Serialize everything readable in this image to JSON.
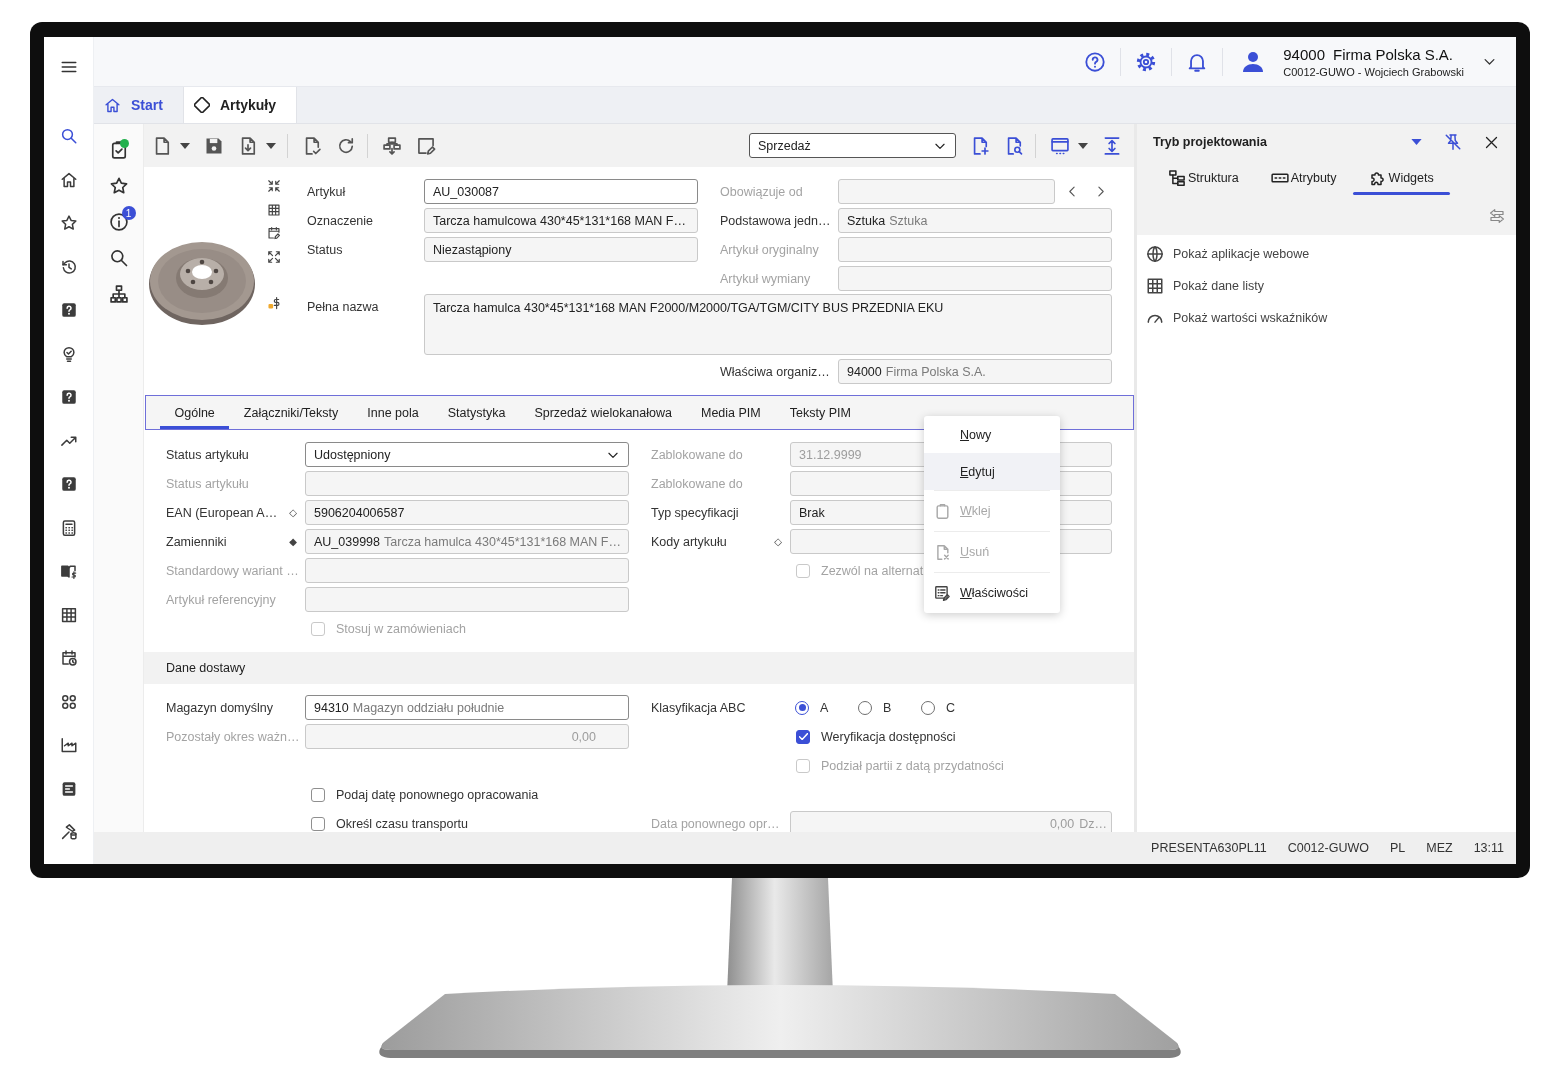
{
  "nav_rail": [
    {
      "selected": true
    },
    {
      "selected": false
    },
    {
      "selected": false
    },
    {
      "selected": false
    },
    {
      "selected": false
    },
    {
      "selected": false
    },
    {
      "selected": false
    },
    {
      "selected": false
    },
    {
      "selected": false
    },
    {
      "selected": false
    },
    {
      "selected": false
    },
    {
      "selected": false
    },
    {
      "selected": false
    },
    {
      "selected": false
    },
    {
      "selected": false
    },
    {
      "selected": false
    },
    {
      "selected": false
    }
  ],
  "top_bar": {
    "company_code": "94000",
    "company_name": "Firma Polska S.A.",
    "user": "C0012-GUWO - Wojciech Grabowski"
  },
  "page_tabs": [
    {
      "label": "Start",
      "kind": "home",
      "selected": false
    },
    {
      "label": "Artykuły",
      "kind": "record",
      "selected": true
    }
  ],
  "tool_rail": {
    "task_dot": true,
    "info_badge": "1"
  },
  "toolbar": {
    "view": "Sprzedaż"
  },
  "article_header": {
    "rows": [
      {
        "left": {
          "kind": "input",
          "label": "Artykuł",
          "value": "AU_030087",
          "editable": true,
          "disabled": false
        },
        "right": {
          "kind": "input",
          "label": "Obowiązuje od",
          "editable": false,
          "disabled": true,
          "nav_arrows": true
        }
      },
      {
        "left": {
          "kind": "input",
          "label": "Oznaczenie",
          "value": "Tarcza hamulcowa 430*45*131*168 MAN F…",
          "editable": false,
          "disabled": false
        },
        "right": {
          "kind": "input",
          "label": "Podstawowa jedn…",
          "value": "Sztuka",
          "description": "Sztuka",
          "editable": false,
          "disabled": false
        }
      },
      {
        "left": {
          "kind": "input",
          "label": "Status",
          "value": "Niezastąpiony",
          "editable": false,
          "disabled": false
        },
        "right": {
          "kind": "input",
          "label": "Artykuł oryginalny",
          "editable": false,
          "disabled": true
        }
      },
      {
        "right": {
          "kind": "input",
          "label": "Artykuł wymiany",
          "editable": false,
          "disabled": true
        }
      },
      {
        "wide": {
          "kind": "textarea",
          "label": "Pełna nazwa",
          "value": "Tarcza hamulca 430*45*131*168 MAN F2000/M2000/TGA/TGM/CITY BUS PRZEDNIA EKU",
          "editable": false,
          "disabled": false
        }
      },
      {
        "right": {
          "kind": "input",
          "label": "Właściwa organiz…",
          "value": "94000",
          "description": "Firma Polska S.A.",
          "editable": false,
          "disabled": false
        }
      }
    ]
  },
  "form_tabs": [
    {
      "label": "Ogólne",
      "selected": true
    },
    {
      "label": "Załączniki/Teksty",
      "selected": false
    },
    {
      "label": "Inne pola",
      "selected": false
    },
    {
      "label": "Statystyka",
      "selected": false
    },
    {
      "label": "Sprzedaż wielokanałowa",
      "selected": false
    },
    {
      "label": "Media PIM",
      "selected": false
    },
    {
      "label": "Teksty PIM",
      "selected": false
    }
  ],
  "general": {
    "rows": [
      {
        "left": {
          "kind": "select",
          "label": "Status artykułu",
          "value": "Udostępniony",
          "editable": true,
          "disabled": false
        },
        "right": {
          "kind": "input",
          "label": "Zablokowane do",
          "value": "31.12.9999",
          "editable": false,
          "disabled": true
        }
      },
      {
        "left": {
          "kind": "input",
          "label": "Status artykułu",
          "editable": false,
          "disabled": true
        },
        "right": {
          "kind": "input",
          "label": "Zablokowane do",
          "editable": false,
          "disabled": true
        }
      },
      {
        "left": {
          "kind": "input",
          "label": "EAN (European A…",
          "marker": "◇",
          "value": "5906204006587",
          "editable": false,
          "disabled": false
        },
        "right": {
          "kind": "input",
          "label": "Typ specyfikacji",
          "value": "Brak",
          "editable": false,
          "disabled": false
        }
      },
      {
        "left": {
          "kind": "input",
          "label": "Zamienniki",
          "marker": "◆",
          "value": "AU_039998",
          "description": "Tarcza hamulca 430*45*131*168 MAN F…",
          "editable": false,
          "disabled": false
        },
        "right": {
          "kind": "input",
          "label": "Kody artykułu",
          "marker": "◇",
          "editable": false,
          "disabled": false
        }
      },
      {
        "left": {
          "kind": "input",
          "label": "Standardowy wariant …",
          "editable": false,
          "disabled": true
        },
        "right": {
          "kind": "checkbox",
          "label": "Zezwól na alternat",
          "checked": false,
          "disabled": true
        }
      },
      {
        "left": {
          "kind": "input",
          "label": "Artykuł referencyjny",
          "editable": false,
          "disabled": true
        }
      },
      {
        "left": {
          "kind": "checkbox",
          "label": "Stosuj w zamówieniach",
          "checked": false,
          "disabled": true
        }
      }
    ]
  },
  "delivery": {
    "title": "Dane dostawy",
    "rows": [
      {
        "left": {
          "kind": "input",
          "label": "Magazyn domyślny",
          "value": "94310",
          "description": "Magazyn oddziału południe",
          "editable": true,
          "disabled": false
        },
        "right": {
          "kind": "radio_group",
          "label": "Klasyfikacja ABC",
          "disabled": false,
          "options": [
            {
              "label": "A",
              "selected": true
            },
            {
              "label": "B",
              "selected": false
            },
            {
              "label": "C",
              "selected": false
            }
          ]
        }
      },
      {
        "left": {
          "kind": "number",
          "label": "Pozostały okres ważn…",
          "value": "0,00",
          "editable": false,
          "disabled": true
        },
        "right": {
          "kind": "checkbox",
          "label": "Weryfikacja dostępności",
          "checked": true,
          "disabled": false
        }
      },
      {
        "right": {
          "kind": "checkbox",
          "label": "Podział partii z datą przydatności",
          "checked": false,
          "disabled": true
        }
      },
      {
        "left": {
          "kind": "checkbox",
          "label": "Podaj datę ponownego opracowania",
          "checked": false,
          "disabled": false
        }
      },
      {
        "left": {
          "kind": "checkbox",
          "label": "Określ czasu transportu",
          "checked": false,
          "disabled": false
        },
        "right": {
          "kind": "number",
          "label": "Data ponownego opr…",
          "value": "0,00",
          "unit": "Dz…",
          "editable": false,
          "disabled": true
        }
      }
    ]
  },
  "context_menu": {
    "items": [
      {
        "label": "Nowy",
        "disabled": false,
        "highlighted": false,
        "separator_before": false
      },
      {
        "label": "Edytuj",
        "disabled": false,
        "highlighted": true,
        "separator_before": false
      },
      {
        "label": "Wklej",
        "disabled": true,
        "highlighted": false,
        "separator_before": true
      },
      {
        "label": "Usuń",
        "disabled": true,
        "highlighted": false,
        "separator_before": true
      },
      {
        "label": "Właściwości",
        "disabled": false,
        "highlighted": false,
        "separator_before": true
      }
    ]
  },
  "design_panel": {
    "title": "Tryb projektowania",
    "tabs": [
      {
        "label": "Struktura",
        "selected": false
      },
      {
        "label": "Atrybuty",
        "selected": false
      },
      {
        "label": "Widgets",
        "selected": true
      }
    ],
    "widgets": [
      {
        "label": "Pokaż aplikacje webowe"
      },
      {
        "label": "Pokaż dane listy"
      },
      {
        "label": "Pokaż wartości wskaźników"
      }
    ]
  },
  "status_bar": [
    "PRESENTA630PL11",
    "C0012-GUWO",
    "PL",
    "MEZ",
    "13:11"
  ]
}
